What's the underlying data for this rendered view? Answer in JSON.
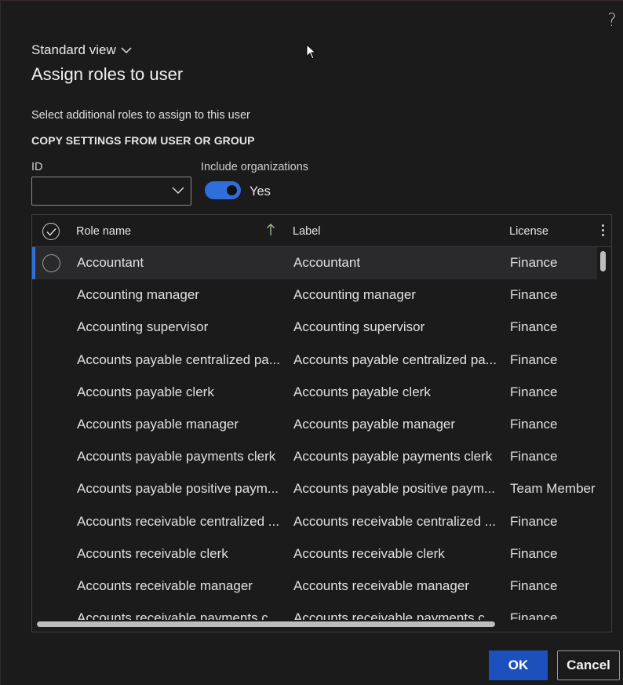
{
  "header": {
    "help_icon": "question-mark-icon",
    "view_name": "Standard view",
    "title": "Assign roles to user"
  },
  "form": {
    "instruction": "Select additional roles to assign to this user",
    "section_header": "COPY SETTINGS FROM USER OR GROUP",
    "id_label": "ID",
    "id_value": "",
    "include_orgs_label": "Include organizations",
    "include_orgs_state": "Yes",
    "toggle_on": true
  },
  "grid": {
    "columns": {
      "role": "Role name",
      "label": "Label",
      "license": "License"
    },
    "sort": {
      "column": "Role name",
      "direction": "ascending"
    },
    "rows": [
      {
        "role": "Accountant",
        "label": "Accountant",
        "license": "Finance"
      },
      {
        "role": "Accounting manager",
        "label": "Accounting manager",
        "license": "Finance"
      },
      {
        "role": "Accounting supervisor",
        "label": "Accounting supervisor",
        "license": "Finance"
      },
      {
        "role": "Accounts payable centralized pa...",
        "label": "Accounts payable centralized pa...",
        "license": "Finance"
      },
      {
        "role": "Accounts payable clerk",
        "label": "Accounts payable clerk",
        "license": "Finance"
      },
      {
        "role": "Accounts payable manager",
        "label": "Accounts payable manager",
        "license": "Finance"
      },
      {
        "role": "Accounts payable payments clerk",
        "label": "Accounts payable payments clerk",
        "license": "Finance"
      },
      {
        "role": "Accounts payable positive paym...",
        "label": "Accounts payable positive paym...",
        "license": "Team Member"
      },
      {
        "role": "Accounts receivable centralized ...",
        "label": "Accounts receivable centralized ...",
        "license": "Finance"
      },
      {
        "role": "Accounts receivable clerk",
        "label": "Accounts receivable clerk",
        "license": "Finance"
      },
      {
        "role": "Accounts receivable manager",
        "label": "Accounts receivable manager",
        "license": "Finance"
      },
      {
        "role": "Accounts receivable payments c...",
        "label": "Accounts receivable payments c...",
        "license": "Finance"
      }
    ]
  },
  "footer": {
    "ok_label": "OK",
    "cancel_label": "Cancel"
  },
  "colors": {
    "accent": "#1d4fbd",
    "toggle": "#2f6fdb",
    "background": "#1b1b1c"
  }
}
